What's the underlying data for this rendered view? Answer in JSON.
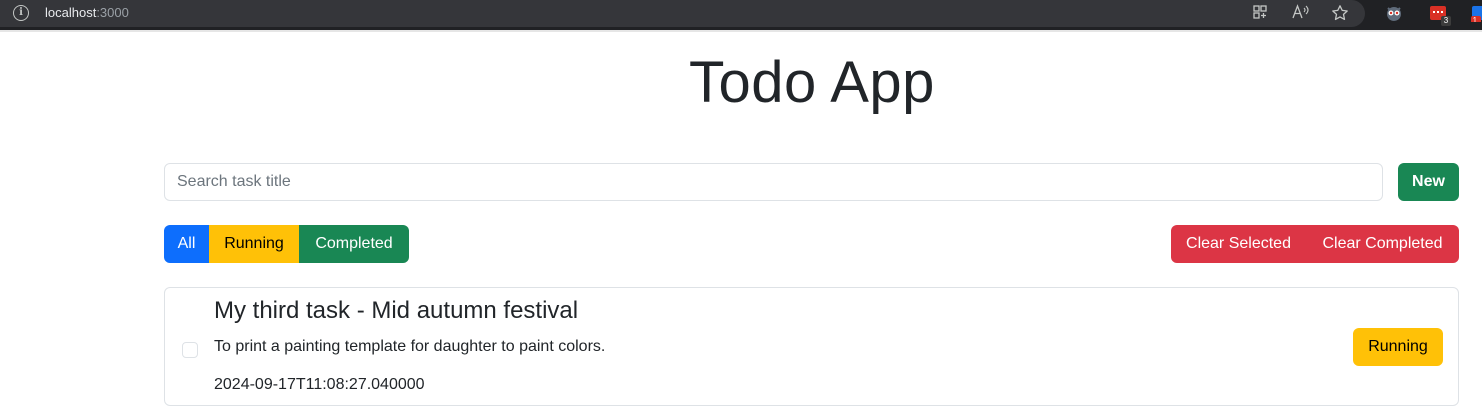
{
  "browser": {
    "url_host": "localhost",
    "url_port": ":3000",
    "icons": [
      "info-icon",
      "grid-icon",
      "read-aloud-icon",
      "favorite-star-icon",
      "extension-owl-icon",
      "extension-red-icon",
      "extension-blue-icon"
    ],
    "extension_badges": [
      "3",
      "1."
    ]
  },
  "app": {
    "title": "Todo App"
  },
  "search": {
    "placeholder": "Search task title",
    "value": ""
  },
  "toolbar": {
    "new_label": "New"
  },
  "filters": {
    "all_label": "All",
    "running_label": "Running",
    "completed_label": "Completed"
  },
  "actions": {
    "clear_selected_label": "Clear Selected",
    "clear_completed_label": "Clear Completed"
  },
  "tasks": [
    {
      "title": "My third task - Mid autumn festival",
      "description": "To print a painting template for daughter to paint colors.",
      "timestamp": "2024-09-17T11:08:27.040000",
      "status": "Running",
      "checked": false
    }
  ],
  "colors": {
    "primary": "#0d6efd",
    "warning": "#ffc107",
    "success": "#198754",
    "danger": "#dc3545"
  }
}
